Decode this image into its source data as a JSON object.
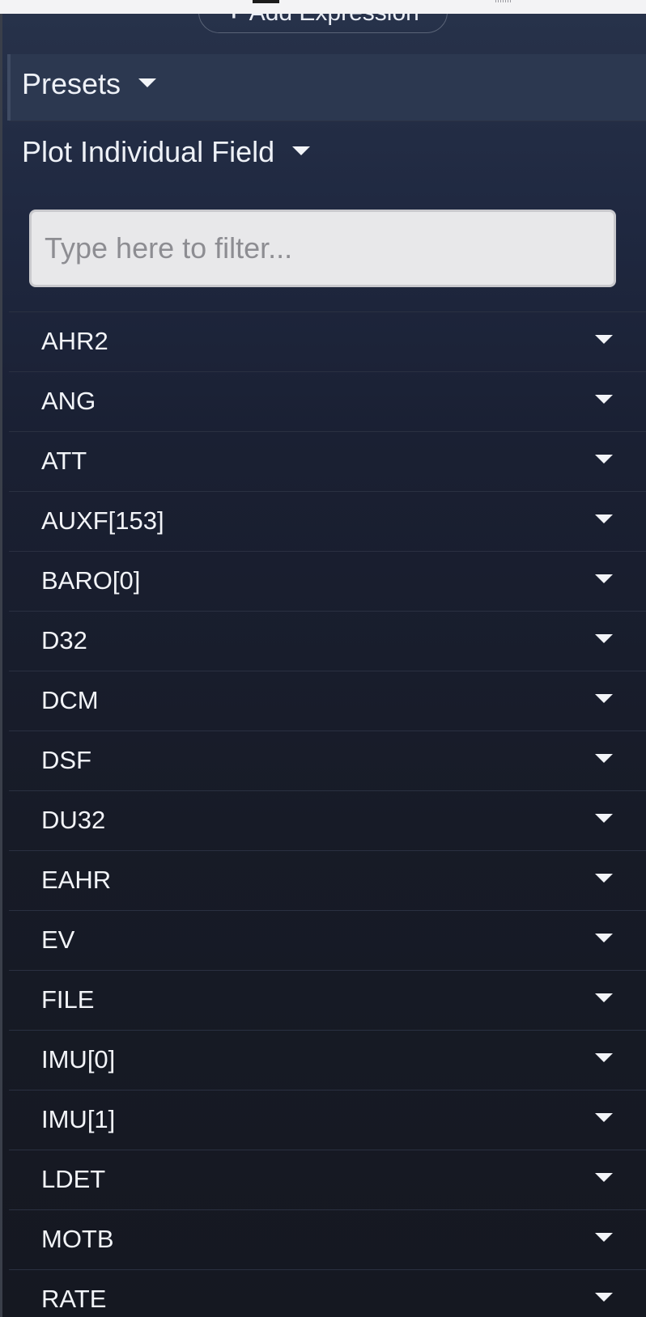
{
  "toolbar": {
    "add_expression_label": "Add Expression",
    "add_expression_icon": "plus-icon"
  },
  "presets": {
    "label": "Presets",
    "icon": "caret-down-icon"
  },
  "plot_individual": {
    "label": "Plot Individual Field",
    "icon": "caret-down-icon"
  },
  "filter": {
    "placeholder": "Type here to filter...",
    "value": ""
  },
  "fields": [
    {
      "label": "AHR2"
    },
    {
      "label": "ANG"
    },
    {
      "label": "ATT"
    },
    {
      "label": "AUXF[153]"
    },
    {
      "label": "BARO[0]"
    },
    {
      "label": "D32"
    },
    {
      "label": "DCM"
    },
    {
      "label": "DSF"
    },
    {
      "label": "DU32"
    },
    {
      "label": "EAHR"
    },
    {
      "label": "EV"
    },
    {
      "label": "FILE"
    },
    {
      "label": "IMU[0]"
    },
    {
      "label": "IMU[1]"
    },
    {
      "label": "LDET"
    },
    {
      "label": "MOTB"
    },
    {
      "label": "RATE"
    }
  ],
  "colors": {
    "panel_bg": "#1f2840",
    "presets_bg": "#2c3850",
    "text": "#eef1f7",
    "input_bg": "#e8e8ea"
  }
}
